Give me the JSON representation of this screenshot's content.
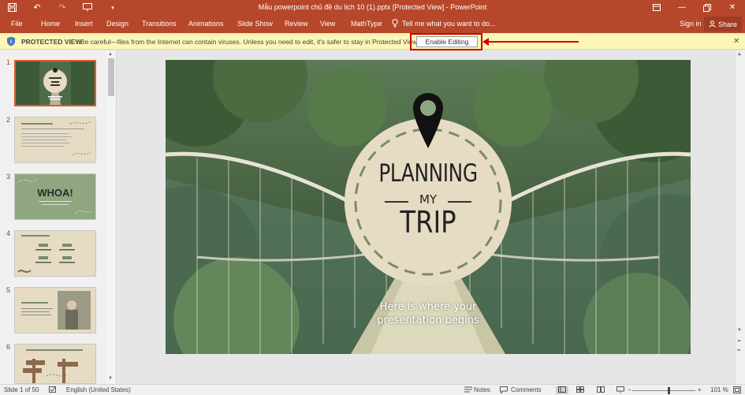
{
  "window": {
    "title": "Mẫu powerpoint chủ đề du lịch 10 (1).pptx [Protected View] - PowerPoint"
  },
  "ribbon": {
    "tabs": [
      "File",
      "Home",
      "Insert",
      "Design",
      "Transitions",
      "Animations",
      "Slide Show",
      "Review",
      "View",
      "MathType"
    ],
    "tell_me": "Tell me what you want to do...",
    "sign_in": "Sign in",
    "share": "Share"
  },
  "protected_view": {
    "title": "PROTECTED VIEW",
    "message": "Be careful—files from the Internet can contain viruses. Unless you need to edit, it's safer to stay in Protected View.",
    "enable_button": "Enable Editing"
  },
  "thumbnails": {
    "numbers": [
      "1",
      "2",
      "3",
      "4",
      "5",
      "6"
    ],
    "slide3_title": "WHOA!"
  },
  "slide": {
    "title_line1": "PLANNING",
    "title_line2": "MY",
    "title_line3": "TRIP",
    "subtitle_line1": "Here is where your",
    "subtitle_line2": "presentation begins"
  },
  "status": {
    "slide_counter": "Slide 1 of 50",
    "language": "English (United States)",
    "notes": "Notes",
    "comments": "Comments",
    "zoom": "101 %"
  },
  "colors": {
    "accent": "#b7472a",
    "protected_bar": "#fcf7b6",
    "highlight": "#d00000",
    "slide_circle": "#e6dcc4"
  }
}
